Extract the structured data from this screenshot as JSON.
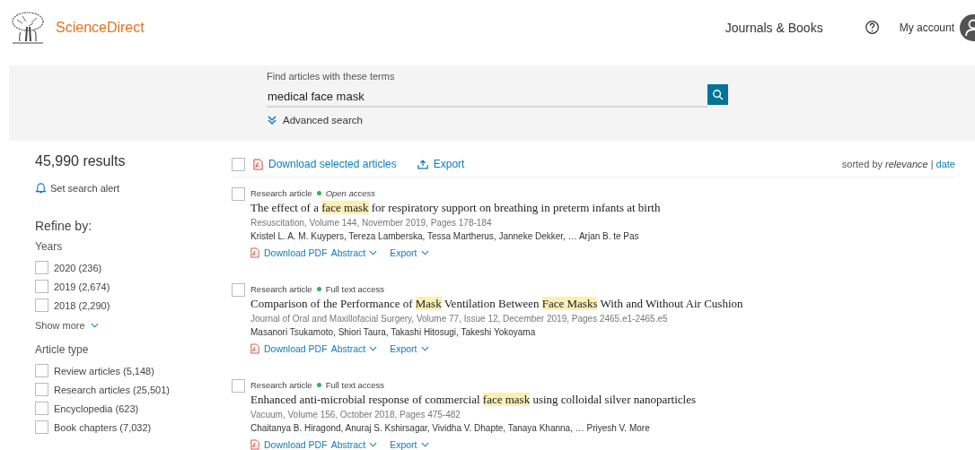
{
  "header": {
    "brand": "ScienceDirect",
    "nav": "Journals & Books",
    "account": "My account"
  },
  "search": {
    "label": "Find articles with these terms",
    "value": "medical face mask",
    "advanced": "Advanced search"
  },
  "sidebar": {
    "results": "45,990 results",
    "alert": "Set search alert",
    "refine": "Refine by:",
    "groups": [
      {
        "title": "Years",
        "items": [
          {
            "label": "2020 (236)",
            "checked": false
          },
          {
            "label": "2019 (2,674)",
            "checked": false
          },
          {
            "label": "2018 (2,290)",
            "checked": false
          }
        ],
        "more": "Show more"
      },
      {
        "title": "Article type",
        "items": [
          {
            "label": "Review articles (5,148)",
            "checked": false
          },
          {
            "label": "Research articles (25,501)",
            "checked": false
          },
          {
            "label": "Encyclopedia (623)",
            "checked": false
          },
          {
            "label": "Book chapters (7,032)",
            "checked": false
          }
        ]
      }
    ]
  },
  "toolbar": {
    "select_all": false,
    "download": "Download selected articles",
    "export": "Export",
    "sort_prefix": "sorted by",
    "sort_separator": "|",
    "sort_options": [
      {
        "label": "relevance",
        "selected": true
      },
      {
        "label": "date",
        "selected": false
      }
    ]
  },
  "results": [
    {
      "checked": false,
      "type": "Research article",
      "access": {
        "label": "Open access",
        "open": true
      },
      "title_parts": [
        {
          "text": "The effect of a ",
          "highlighted": false
        },
        {
          "text": "face mask",
          "highlighted": true
        },
        {
          "text": " for respiratory support on breathing in preterm infants at birth",
          "highlighted": false
        }
      ],
      "source": "Resuscitation, Volume 144, November 2019, Pages 178-184",
      "authors": "Kristel L. A. M. Kuypers, Tereza Lamberska, Tessa Martherus, Janneke Dekker, … Arjan B. te Pas",
      "actions": [
        "Download PDF",
        "Abstract",
        "Export"
      ]
    },
    {
      "checked": false,
      "type": "Research article",
      "access": {
        "label": "Full text access",
        "open": false
      },
      "title_parts": [
        {
          "text": "Comparison of the Performance of ",
          "highlighted": false
        },
        {
          "text": "Mask",
          "highlighted": true
        },
        {
          "text": " Ventilation Between ",
          "highlighted": false
        },
        {
          "text": "Face Masks",
          "highlighted": true
        },
        {
          "text": " With and Without Air Cushion",
          "highlighted": false
        }
      ],
      "source": "Journal of Oral and Maxillofacial Surgery, Volume 77, Issue 12, December 2019, Pages 2465.e1-2465.e5",
      "authors": "Masanori Tsukamoto, Shiori Taura, Takashi Hitosugi, Takeshi Yokoyama",
      "actions": [
        "Download PDF",
        "Abstract",
        "Export"
      ]
    },
    {
      "checked": false,
      "type": "Research article",
      "access": {
        "label": "Full text access",
        "open": false
      },
      "title_parts": [
        {
          "text": "Enhanced anti-microbial response of commercial ",
          "highlighted": false
        },
        {
          "text": "face mask",
          "highlighted": true
        },
        {
          "text": " using colloidal silver nanoparticles",
          "highlighted": false
        }
      ],
      "source": "Vacuum, Volume 156, October 2018, Pages 475-482",
      "authors": "Chaitanya B. Hiragond, Anuraj S. Kshirsagar, Vividha V. Dhapte, Tanaya Khanna, … Priyesh V. More",
      "actions": [
        "Download PDF",
        "Abstract",
        "Export"
      ]
    }
  ]
}
